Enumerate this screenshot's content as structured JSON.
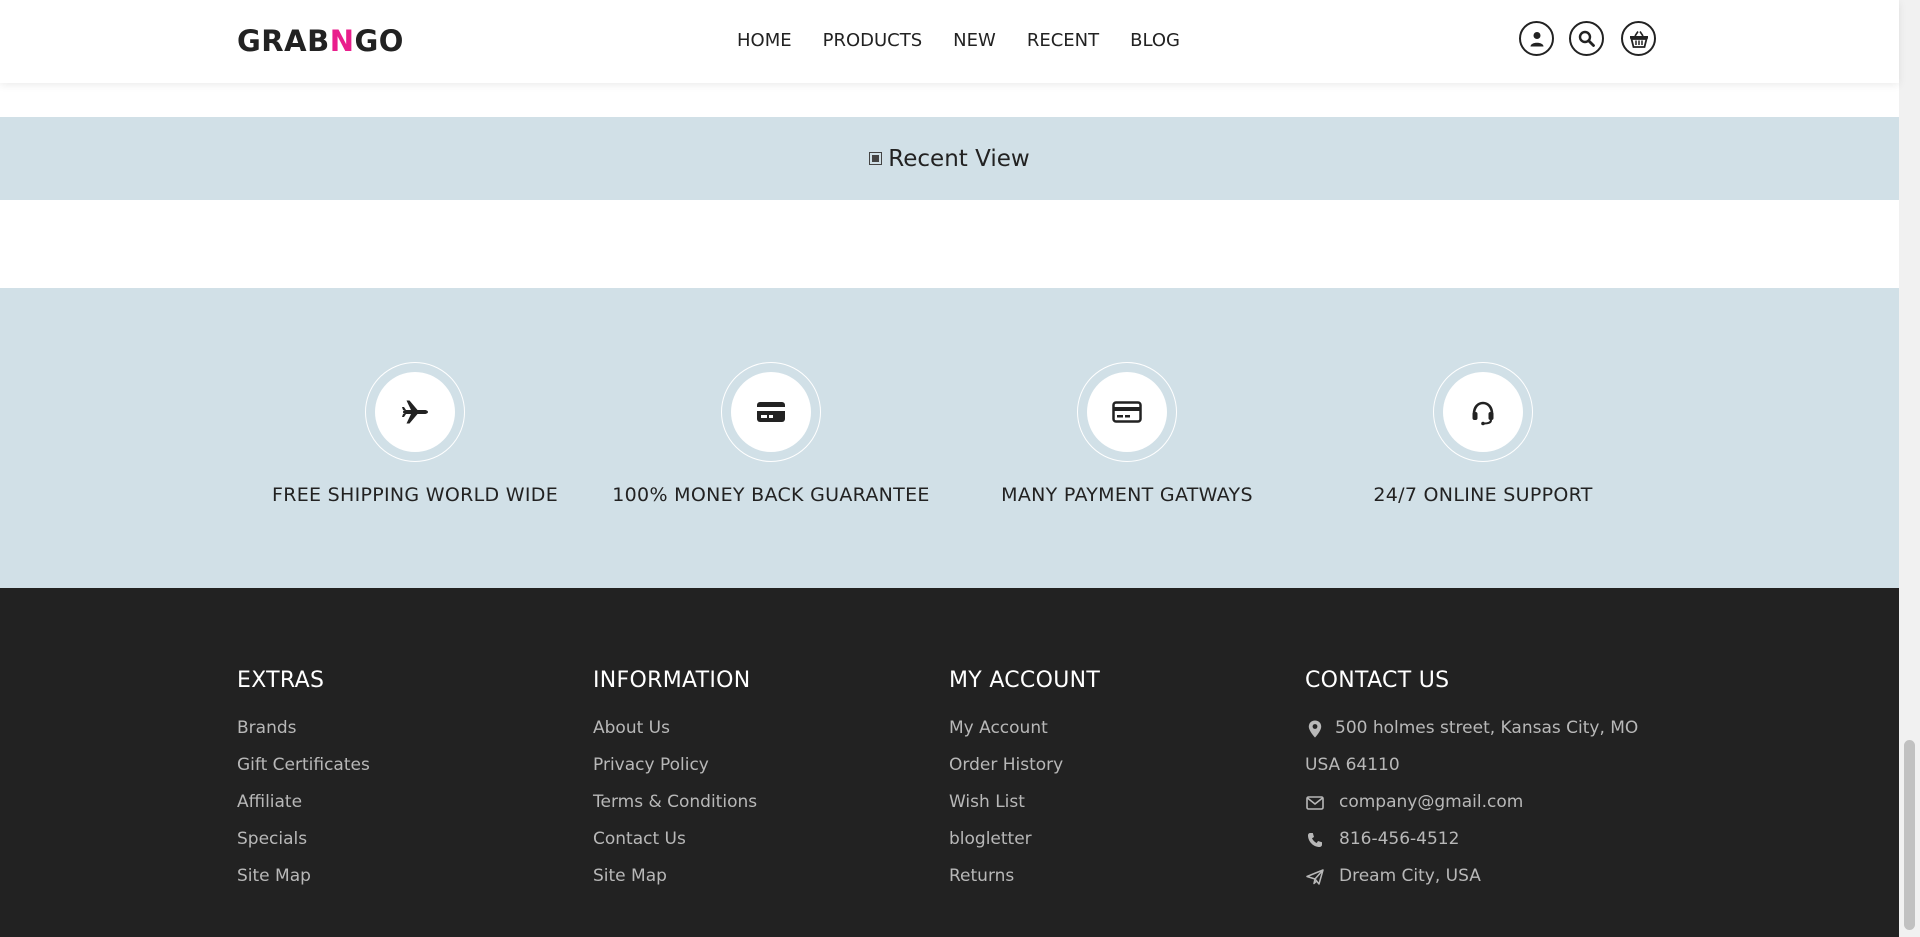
{
  "header": {
    "logo_part1": "GRAB",
    "logo_accent": "N",
    "logo_part2": "GO",
    "nav": [
      "HOME",
      "PRODUCTS",
      "NEW",
      "RECENT",
      "BLOG"
    ]
  },
  "icons": {
    "account": "user-icon",
    "search": "search-icon",
    "cart": "basket-icon"
  },
  "recent": {
    "title": "Recent View"
  },
  "features": [
    {
      "icon": "airplane-icon",
      "label": "FREE SHIPPING WORLD WIDE"
    },
    {
      "icon": "credit-card-icon",
      "label": "100% MONEY BACK GUARANTEE"
    },
    {
      "icon": "payment-card-icon",
      "label": "MANY PAYMENT GATWAYS"
    },
    {
      "icon": "headset-icon",
      "label": "24/7 ONLINE SUPPORT"
    }
  ],
  "footer": {
    "extras": {
      "heading": "EXTRAS",
      "links": [
        "Brands",
        "Gift Certificates",
        "Affiliate",
        "Specials",
        "Site Map"
      ]
    },
    "information": {
      "heading": "INFORMATION",
      "links": [
        "About Us",
        "Privacy Policy",
        "Terms & Conditions",
        "Contact Us",
        "Site Map"
      ]
    },
    "account": {
      "heading": "MY ACCOUNT",
      "links": [
        "My Account",
        "Order History",
        "Wish List",
        "blogletter",
        "Returns"
      ]
    },
    "contact": {
      "heading": "CONTACT US",
      "address_line1": "500 holmes street, Kansas City, MO",
      "address_line2": "USA 64110",
      "email": "company@gmail.com",
      "phone": "816-456-4512",
      "location": "Dream City, USA"
    }
  },
  "colors": {
    "accent": "#e91e8c",
    "band": "#d1e0e7",
    "footer": "#222222"
  }
}
